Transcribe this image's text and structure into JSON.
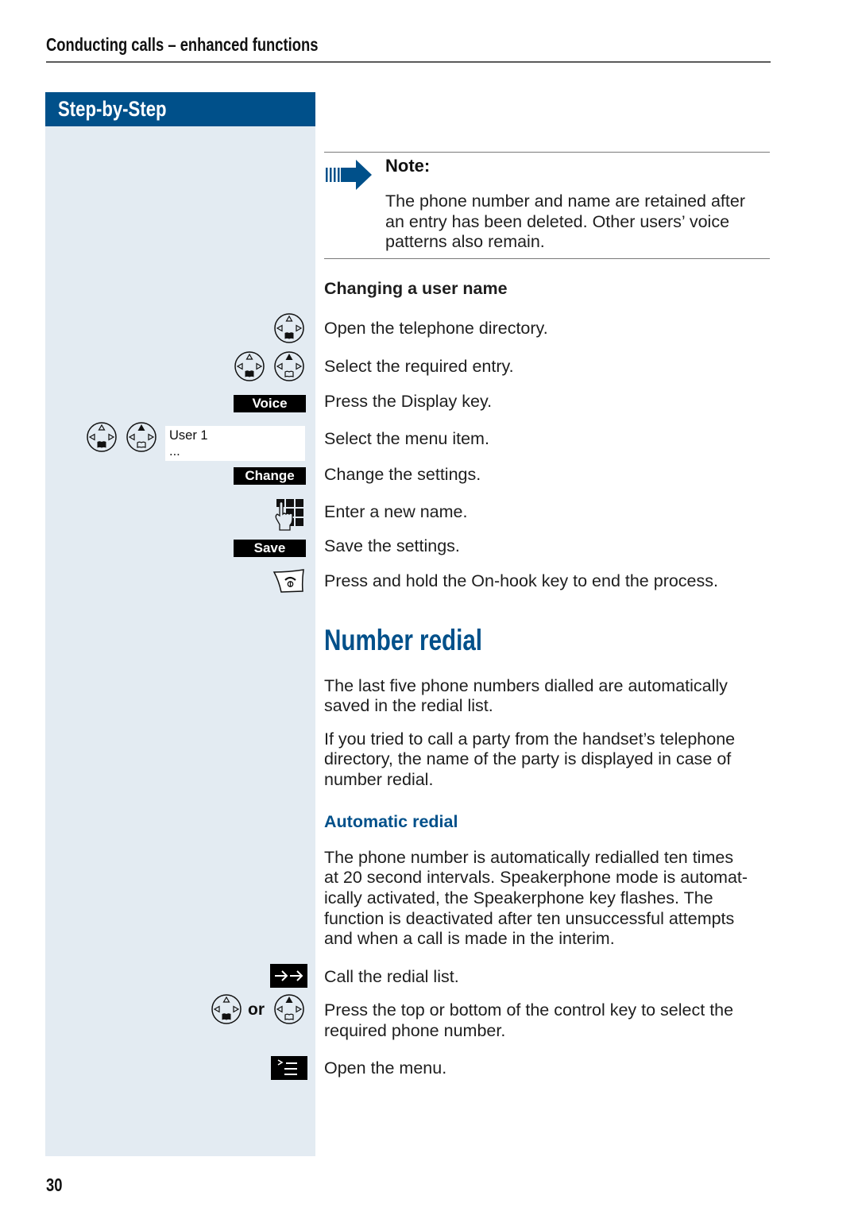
{
  "header": {
    "section_title": "Conducting calls – enhanced functions"
  },
  "colors": {
    "brand_blue": "#00508a",
    "sidebar_background": "#e3ebf2",
    "softkey_background": "#000000",
    "softkey_text": "#ffffff"
  },
  "sidebar": {
    "title": "Step-by-Step",
    "softkeys": {
      "voice": "Voice",
      "change": "Change",
      "save": "Save"
    },
    "display": {
      "line1": "User 1",
      "line2": "..."
    },
    "or_label": "or"
  },
  "note": {
    "icon": "note-arrow-icon",
    "title": "Note:",
    "lines": [
      "The phone number and name are retained after",
      "an entry has been deleted. Other users’ voice",
      "patterns also remain."
    ]
  },
  "changing_user_name": {
    "heading": "Changing a user name",
    "steps": [
      {
        "icons": [
          "control-key-bottom-icon"
        ],
        "text": "Open the telephone directory."
      },
      {
        "icons": [
          "control-key-bottom-icon",
          "control-key-top-icon"
        ],
        "text": "Select the required entry."
      },
      {
        "icons": [
          "softkey-voice"
        ],
        "text": "Press the Display key."
      },
      {
        "icons": [
          "control-key-bottom-icon",
          "control-key-top-icon",
          "display-user-1"
        ],
        "text": "Select the menu item."
      },
      {
        "icons": [
          "softkey-change"
        ],
        "text": "Change the settings."
      },
      {
        "icons": [
          "keypad-icon"
        ],
        "text": "Enter a new name."
      },
      {
        "icons": [
          "softkey-save"
        ],
        "text": "Save the settings."
      },
      {
        "icons": [
          "on-hook-key-icon"
        ],
        "text": "Press and hold the On-hook key to end the process."
      }
    ]
  },
  "number_redial": {
    "heading": "Number redial",
    "paragraphs": [
      [
        "The last five phone numbers dialled are automatically",
        "saved in the redial list."
      ],
      [
        "If you tried to call a party from the handset’s telephone",
        "directory, the name of the party is displayed in case of",
        "number redial."
      ]
    ],
    "automatic_redial": {
      "heading": "Automatic redial",
      "lines": [
        "The phone number is automatically redialled ten times",
        "at 20 second intervals. Speakerphone mode is automat-",
        "ically activated, the Speakerphone key flashes. The",
        "function is deactivated after ten unsuccessful attempts",
        "and when a call is made in the interim."
      ]
    },
    "steps": [
      {
        "icons": [
          "redial-key-icon"
        ],
        "lines": [
          "Call the redial list."
        ]
      },
      {
        "icons": [
          "control-key-bottom-icon",
          "control-key-top-icon"
        ],
        "lines": [
          "Press the top or bottom of the control key to select the",
          "required phone number."
        ]
      },
      {
        "icons": [
          "menu-key-icon"
        ],
        "lines": [
          "Open the menu."
        ]
      }
    ]
  },
  "page_number": "30"
}
